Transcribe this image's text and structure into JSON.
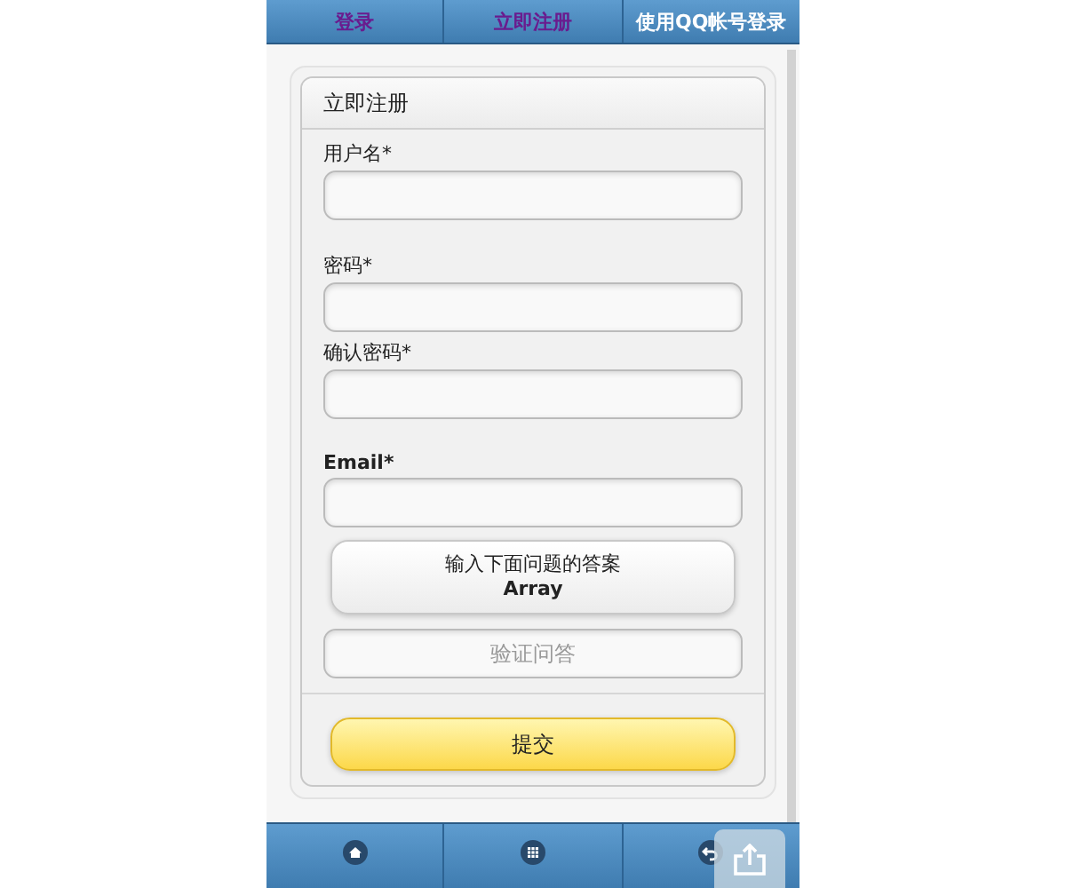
{
  "top_nav": [
    {
      "label": "登录",
      "visited": true
    },
    {
      "label": "立即注册",
      "visited": true
    },
    {
      "label": "使用QQ帐号登录",
      "visited": false
    }
  ],
  "form": {
    "title": "立即注册",
    "fields": [
      {
        "label": "用户名*",
        "kind": "text"
      },
      {
        "label": "密码*",
        "kind": "password"
      },
      {
        "label": "确认密码*",
        "kind": "password"
      },
      {
        "label": "Email*",
        "kind": "email"
      }
    ],
    "question_button": {
      "line_1": "输入下面问题的答案",
      "line_2": "Array"
    },
    "answer": {
      "placeholder": "验证问答"
    },
    "submit": "提交"
  },
  "bottom_nav": [
    {
      "kind": "home"
    },
    {
      "kind": "grid"
    },
    {
      "kind": "back"
    }
  ]
}
